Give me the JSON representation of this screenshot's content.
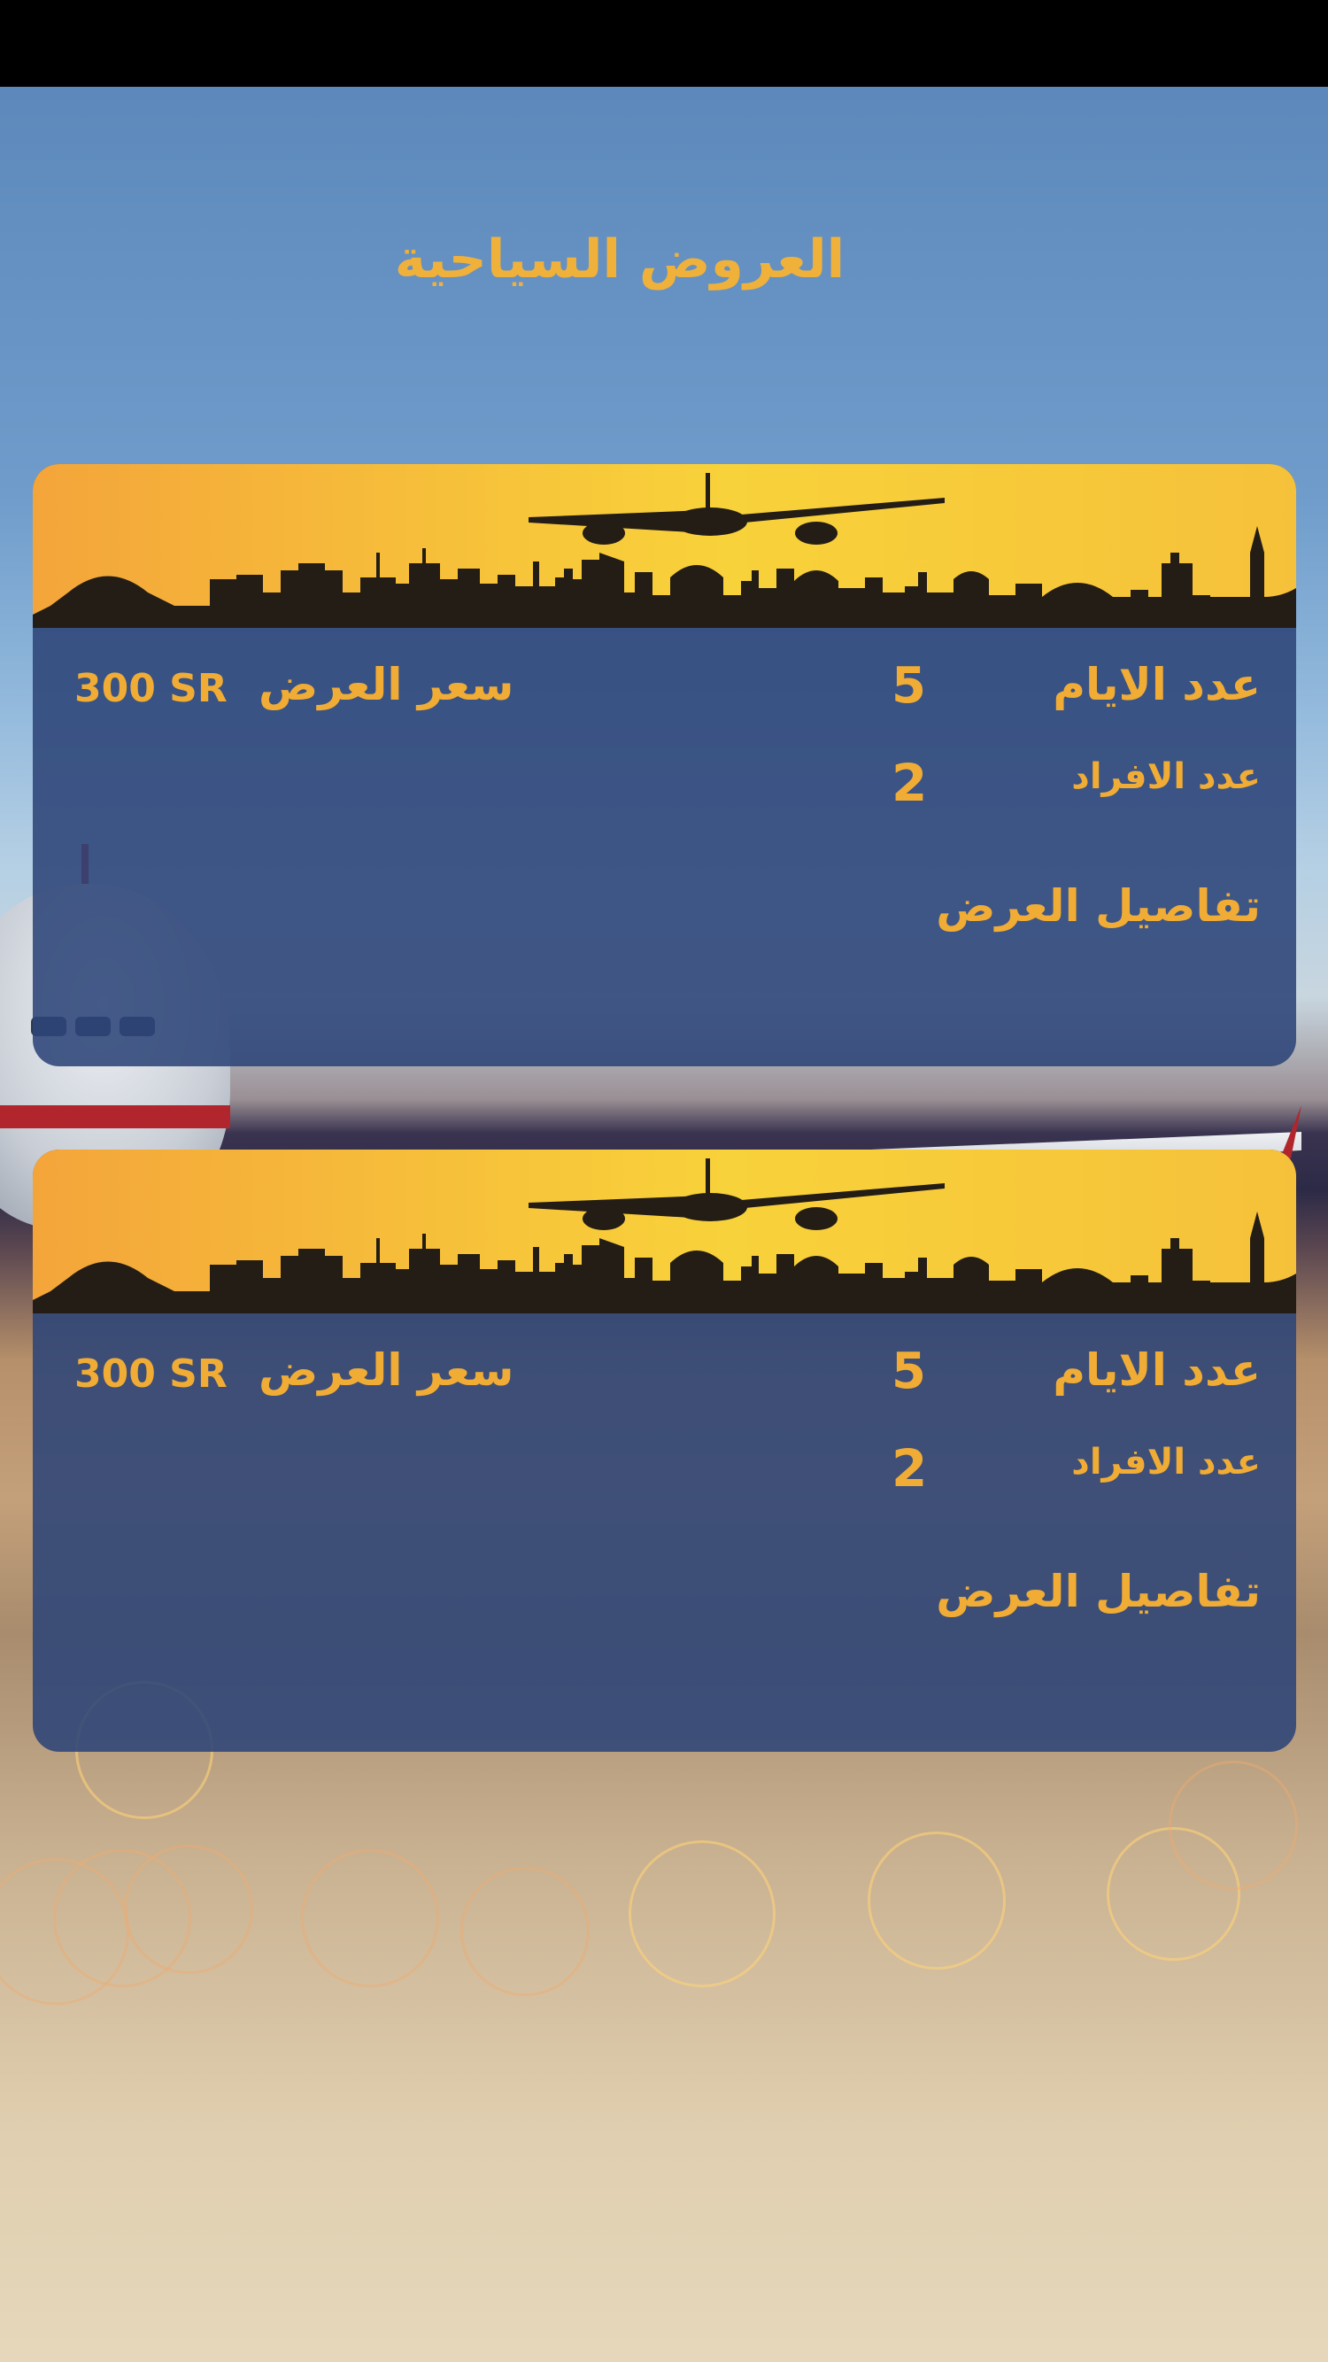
{
  "page": {
    "title": "العروض السياحية"
  },
  "offers": [
    {
      "days_label": "عدد الايام",
      "days_value": "5",
      "people_label": "عدد الافراد",
      "people_value": "2",
      "price_label": "سعر العرض",
      "price_value": "300 SR",
      "details_label": "تفاصيل العرض"
    },
    {
      "days_label": "عدد الايام",
      "days_value": "5",
      "people_label": "عدد الافراد",
      "people_value": "2",
      "price_label": "سعر العرض",
      "price_value": "300 SR",
      "details_label": "تفاصيل العرض"
    }
  ],
  "icons": {
    "banner": "airplane-skyline-icon"
  },
  "colors": {
    "accent": "#f0ac35",
    "card_background": "#2c4478",
    "banner_gradient_start": "#f4a53a",
    "banner_gradient_end": "#f8d23a",
    "status_bar": "#000000"
  }
}
